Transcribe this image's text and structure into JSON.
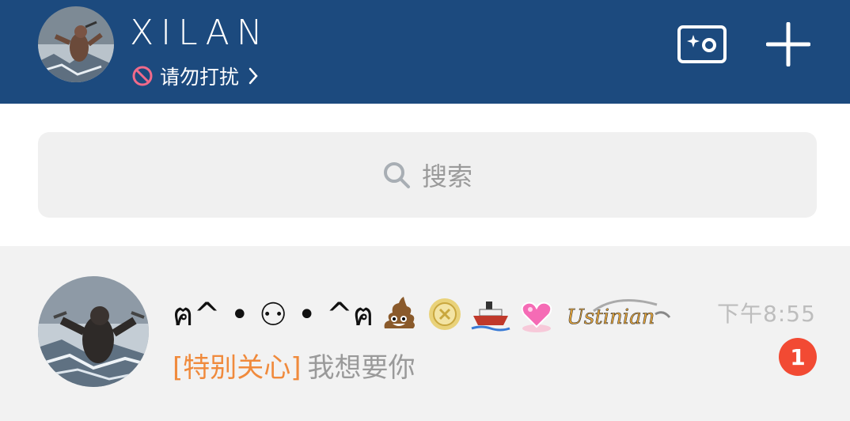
{
  "header": {
    "username": "XILAN",
    "status_text": "请勿打扰",
    "status_icon": "do-not-disturb-icon",
    "camera_icon": "camera-icon",
    "add_icon": "plus-icon",
    "bar_color": "#1c4a7e"
  },
  "search": {
    "placeholder": "搜索",
    "icon": "search-icon"
  },
  "conversations": [
    {
      "name": "ฅ^•ω•^ฅ",
      "name_display": "ฅ^ • ⚇ • ^ฅ",
      "badges": [
        "poop-emoji-icon",
        "gold-medal-icon",
        "ship-icon",
        "pink-heart-icon",
        "ustinian-badge-icon"
      ],
      "badge_text": "Ustinian",
      "time": "下午8:55",
      "tag": "[特别关心]",
      "message": "我想要你",
      "unread_count": "1",
      "unread_color": "#f24a33",
      "tag_color": "#f08a3c"
    }
  ]
}
